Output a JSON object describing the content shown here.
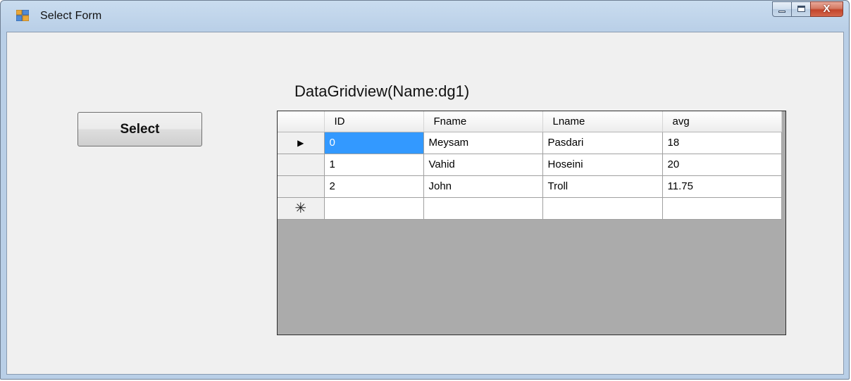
{
  "window": {
    "title": "Select Form",
    "icon": "form-icon",
    "controls": {
      "minimize_icon": "minimize-icon",
      "maximize_icon": "maximize-icon",
      "close_glyph": "X"
    }
  },
  "form": {
    "select_button_label": "Select",
    "grid_caption": "DataGridview(Name:dg1)"
  },
  "grid": {
    "columns": [
      "ID",
      "Fname",
      "Lname",
      "avg"
    ],
    "rows": [
      {
        "marker": "▶",
        "cells": [
          "0",
          "Meysam",
          "Pasdari",
          "18"
        ],
        "selected_cell": 0
      },
      {
        "marker": "",
        "cells": [
          "1",
          "Vahid",
          "Hoseini",
          "20"
        ]
      },
      {
        "marker": "",
        "cells": [
          "2",
          "John",
          "Troll",
          "11.75"
        ]
      }
    ],
    "new_row_marker": "✳",
    "colors": {
      "selection": "#3399ff",
      "background": "#ababab"
    }
  }
}
